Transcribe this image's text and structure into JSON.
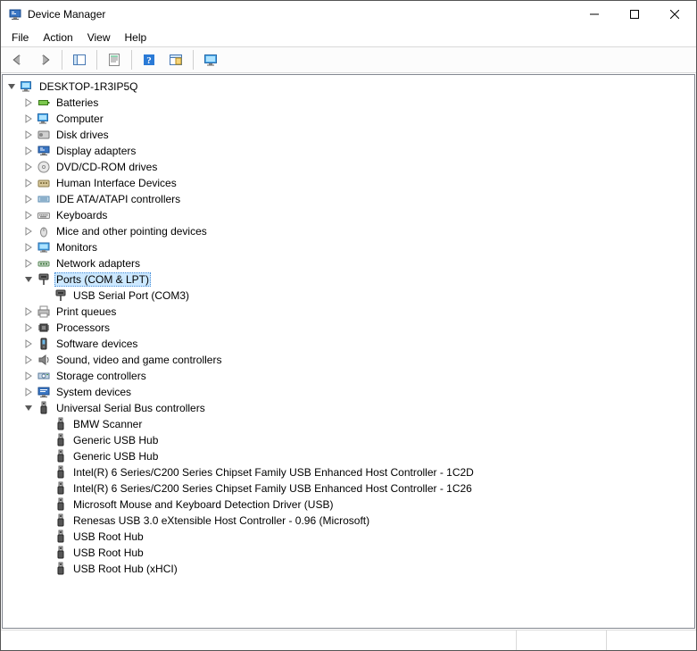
{
  "window": {
    "title": "Device Manager"
  },
  "menu": {
    "items": [
      "File",
      "Action",
      "View",
      "Help"
    ]
  },
  "toolbar": {
    "buttons": [
      {
        "name": "back",
        "icon": "arrow-left"
      },
      {
        "name": "forward",
        "icon": "arrow-right"
      },
      {
        "name": "show-hide-tree",
        "icon": "panel"
      },
      {
        "name": "properties",
        "icon": "sheet"
      },
      {
        "name": "help",
        "icon": "help"
      },
      {
        "name": "scan",
        "icon": "scan"
      },
      {
        "name": "view",
        "icon": "monitor"
      }
    ]
  },
  "tree": {
    "root": {
      "label": "DESKTOP-1R3IP5Q",
      "icon": "computer",
      "expanded": true,
      "children": [
        {
          "label": "Batteries",
          "icon": "battery",
          "expanded": false,
          "children": [
            {}
          ]
        },
        {
          "label": "Computer",
          "icon": "computer",
          "expanded": false,
          "children": [
            {}
          ]
        },
        {
          "label": "Disk drives",
          "icon": "disk",
          "expanded": false,
          "children": [
            {}
          ]
        },
        {
          "label": "Display adapters",
          "icon": "display",
          "expanded": false,
          "children": [
            {}
          ]
        },
        {
          "label": "DVD/CD-ROM drives",
          "icon": "cd",
          "expanded": false,
          "children": [
            {}
          ]
        },
        {
          "label": "Human Interface Devices",
          "icon": "hid",
          "expanded": false,
          "children": [
            {}
          ]
        },
        {
          "label": "IDE ATA/ATAPI controllers",
          "icon": "ide",
          "expanded": false,
          "children": [
            {}
          ]
        },
        {
          "label": "Keyboards",
          "icon": "keyboard",
          "expanded": false,
          "children": [
            {}
          ]
        },
        {
          "label": "Mice and other pointing devices",
          "icon": "mouse",
          "expanded": false,
          "children": [
            {}
          ]
        },
        {
          "label": "Monitors",
          "icon": "monitor",
          "expanded": false,
          "children": [
            {}
          ]
        },
        {
          "label": "Network adapters",
          "icon": "network",
          "expanded": false,
          "children": [
            {}
          ]
        },
        {
          "label": "Ports (COM & LPT)",
          "icon": "port",
          "expanded": true,
          "selected": true,
          "children": [
            {
              "label": "USB Serial Port (COM3)",
              "icon": "port"
            }
          ]
        },
        {
          "label": "Print queues",
          "icon": "printer",
          "expanded": false,
          "children": [
            {}
          ]
        },
        {
          "label": "Processors",
          "icon": "cpu",
          "expanded": false,
          "children": [
            {}
          ]
        },
        {
          "label": "Software devices",
          "icon": "software",
          "expanded": false,
          "children": [
            {}
          ]
        },
        {
          "label": "Sound, video and game controllers",
          "icon": "sound",
          "expanded": false,
          "children": [
            {}
          ]
        },
        {
          "label": "Storage controllers",
          "icon": "storage",
          "expanded": false,
          "children": [
            {}
          ]
        },
        {
          "label": "System devices",
          "icon": "system",
          "expanded": false,
          "children": [
            {}
          ]
        },
        {
          "label": "Universal Serial Bus controllers",
          "icon": "usb",
          "expanded": true,
          "children": [
            {
              "label": "BMW Scanner",
              "icon": "usb"
            },
            {
              "label": "Generic USB Hub",
              "icon": "usb"
            },
            {
              "label": "Generic USB Hub",
              "icon": "usb"
            },
            {
              "label": "Intel(R) 6 Series/C200 Series Chipset Family USB Enhanced Host Controller - 1C2D",
              "icon": "usb"
            },
            {
              "label": "Intel(R) 6 Series/C200 Series Chipset Family USB Enhanced Host Controller - 1C26",
              "icon": "usb"
            },
            {
              "label": "Microsoft Mouse and Keyboard Detection Driver (USB)",
              "icon": "usb"
            },
            {
              "label": "Renesas USB 3.0 eXtensible Host Controller - 0.96 (Microsoft)",
              "icon": "usb"
            },
            {
              "label": "USB Root Hub",
              "icon": "usb"
            },
            {
              "label": "USB Root Hub",
              "icon": "usb"
            },
            {
              "label": "USB Root Hub (xHCI)",
              "icon": "usb"
            }
          ]
        }
      ]
    }
  }
}
